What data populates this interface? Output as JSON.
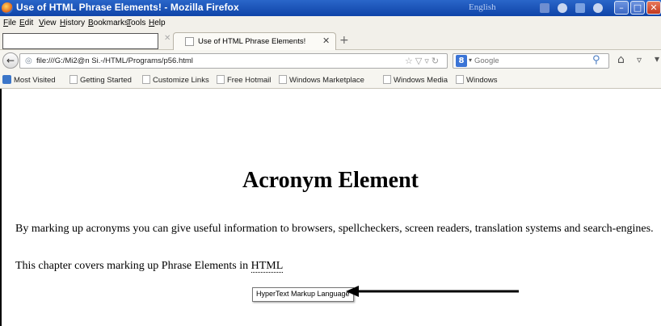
{
  "window": {
    "title": "Use of HTML Phrase Elements! - Mozilla Firefox",
    "language_indicator": "English"
  },
  "menu": {
    "items": [
      "File",
      "Edit",
      "View",
      "History",
      "Bookmarks",
      "Tools",
      "Help"
    ]
  },
  "tabs": {
    "active_label": "Use of HTML Phrase Elements!"
  },
  "navigation": {
    "url": "file:///G:/Mi2@n Si.-/HTML/Programs/p56.html",
    "search_placeholder": "Google"
  },
  "bookmarks": {
    "items": [
      "Most Visited",
      "Getting Started",
      "Customize Links",
      "Free Hotmail",
      "Windows Marketplace",
      "Windows Media",
      "Windows"
    ]
  },
  "page": {
    "heading": "Acronym Element",
    "paragraph1": "By marking up acronyms you can give useful information to browsers, spellcheckers, screen readers, translation systems and search-engines.",
    "paragraph2_prefix": "This chapter covers marking up Phrase Elements in ",
    "acronym": "HTML",
    "tooltip": "HyperText Markup Language"
  }
}
